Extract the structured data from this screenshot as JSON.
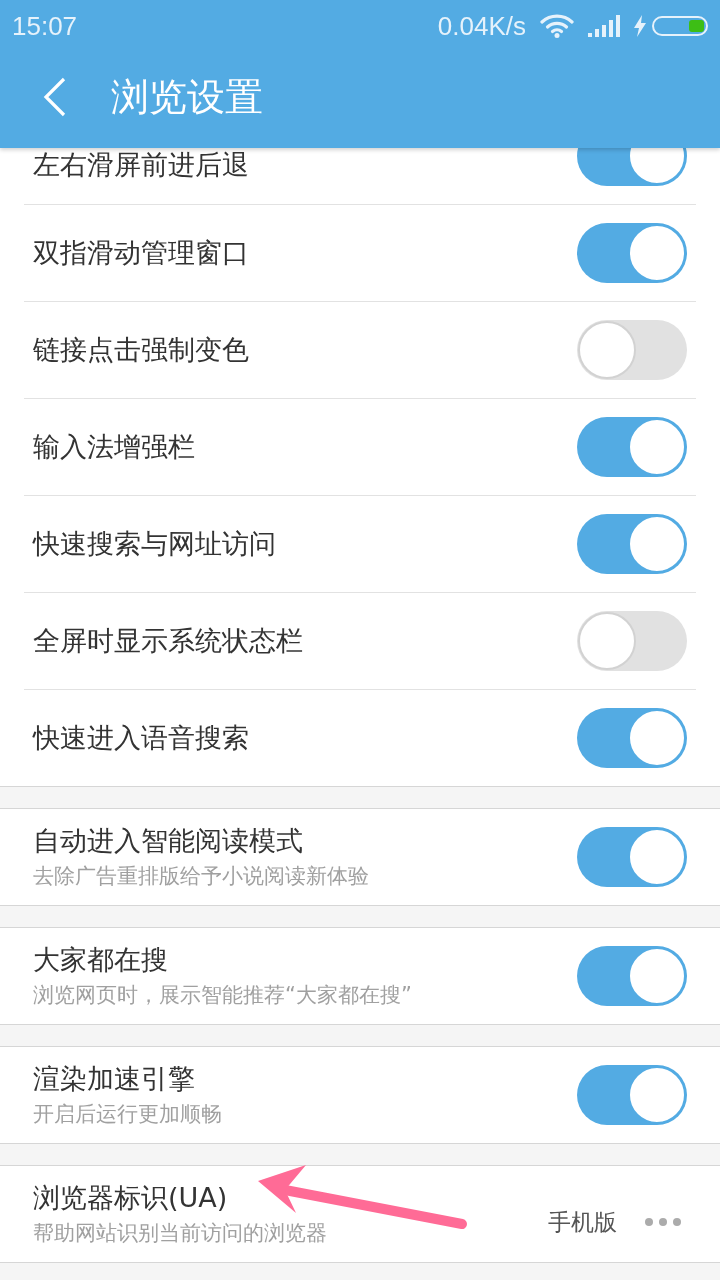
{
  "status_bar": {
    "time": "15:07",
    "network_speed": "0.04K/s"
  },
  "app_bar": {
    "title": "浏览设置"
  },
  "sections": [
    {
      "items": [
        {
          "title": "左右滑屏前进后退",
          "kind": "toggle",
          "on": true,
          "cut_off": true
        },
        {
          "title": "双指滑动管理窗口",
          "kind": "toggle",
          "on": true,
          "cut_off": false
        },
        {
          "title": "链接点击强制变色",
          "kind": "toggle",
          "on": false,
          "cut_off": false
        },
        {
          "title": "输入法增强栏",
          "kind": "toggle",
          "on": true,
          "cut_off": false
        },
        {
          "title": "快速搜索与网址访问",
          "kind": "toggle",
          "on": true,
          "cut_off": false
        },
        {
          "title": "全屏时显示系统状态栏",
          "kind": "toggle",
          "on": false,
          "cut_off": false
        },
        {
          "title": "快速进入语音搜索",
          "kind": "toggle",
          "on": true,
          "cut_off": false
        }
      ]
    },
    {
      "items": [
        {
          "title": "自动进入智能阅读模式",
          "subtitle": "去除广告重排版给予小说阅读新体验",
          "kind": "toggle",
          "on": true,
          "cut_off": false
        }
      ]
    },
    {
      "items": [
        {
          "title": "大家都在搜",
          "subtitle": "浏览网页时，展示智能推荐“大家都在搜”",
          "kind": "toggle",
          "on": true,
          "cut_off": false
        }
      ]
    },
    {
      "items": [
        {
          "title": "渲染加速引擎",
          "subtitle": "开启后运行更加顺畅",
          "kind": "toggle",
          "on": true,
          "cut_off": false
        }
      ]
    },
    {
      "items": [
        {
          "title": "浏览器标识(UA)",
          "subtitle": "帮助网站识别当前访问的浏览器",
          "kind": "choice",
          "value": "手机版",
          "cut_off": false
        }
      ]
    }
  ]
}
